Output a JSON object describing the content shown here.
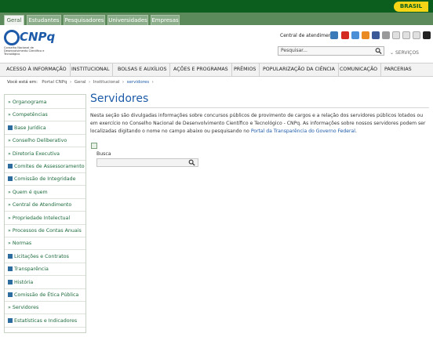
{
  "gov_bar": {
    "brasil_label": "BRASIL"
  },
  "top_tabs": [
    "Geral",
    "Estudantes",
    "Pesquisadores",
    "Universidades",
    "Empresas"
  ],
  "header": {
    "logo_text": "CNPq",
    "logo_subtitle": "Conselho Nacional de Desenvolvimento Científico e Tecnológico",
    "central_label": "Central de atendimento",
    "search_placeholder": "Pesquisar...",
    "servicos_label": "SERVIÇOS"
  },
  "nav": [
    "Acesso à informação",
    "Institucional",
    "Bolsas e Auxílios",
    "Ações e Programas",
    "Prêmios",
    "Popularização da Ciência",
    "Comunicação",
    "Parcerias"
  ],
  "breadcrumb": {
    "label": "Você está em:",
    "items": [
      "Portal CNPq",
      "Geral",
      "Institucional",
      "servidores"
    ]
  },
  "sidebar": {
    "items": [
      {
        "label": "Organograma",
        "marker": "bullet"
      },
      {
        "label": "Competências",
        "marker": "bullet"
      },
      {
        "label": "Base Jurídica",
        "marker": "box"
      },
      {
        "label": "Conselho Deliberativo",
        "marker": "bullet"
      },
      {
        "label": "Diretoria Executiva",
        "marker": "bullet"
      },
      {
        "label": "Comites de Assessoramento",
        "marker": "box"
      },
      {
        "label": "Comissão de Integridade",
        "marker": "box"
      },
      {
        "label": "Quem é quem",
        "marker": "bullet"
      },
      {
        "label": "Central de Atendimento",
        "marker": "bullet"
      },
      {
        "label": "Propriedade Intelectual",
        "marker": "bullet"
      },
      {
        "label": "Processos de Contas Anuais",
        "marker": "bullet"
      },
      {
        "label": "Normas",
        "marker": "bullet"
      },
      {
        "label": "Licitações e Contratos",
        "marker": "box"
      },
      {
        "label": "Transparência",
        "marker": "box"
      },
      {
        "label": "História",
        "marker": "box"
      },
      {
        "label": "Comissão de Ética Pública",
        "marker": "box"
      },
      {
        "label": "Servidores",
        "marker": "bullet"
      },
      {
        "label": "Estatísticas e Indicadores",
        "marker": "box"
      }
    ]
  },
  "content": {
    "title": "Servidores",
    "paragraph": "Nesta seção são divulgadas informações sobre concursos públicos de provimento de cargos e a relação dos servidores públicos lotados ou em exercício no Conselho Nacional de Desenvolvimento Científico e Tecnológico - CNPq.  As informações sobre nossos servidores podem ser localizadas digitando o nome no campo abaixo ou pesquisando no ",
    "link_text": "Portal da Transparência do Governo Federal",
    "paragraph_end": ".",
    "busca_label": "Busca"
  },
  "colors": {
    "gov_green": "#0b5e1e",
    "brasil_yellow": "#f5d516",
    "brand_blue": "#1d5aa8",
    "sidebar_green": "#1d6b3c"
  }
}
